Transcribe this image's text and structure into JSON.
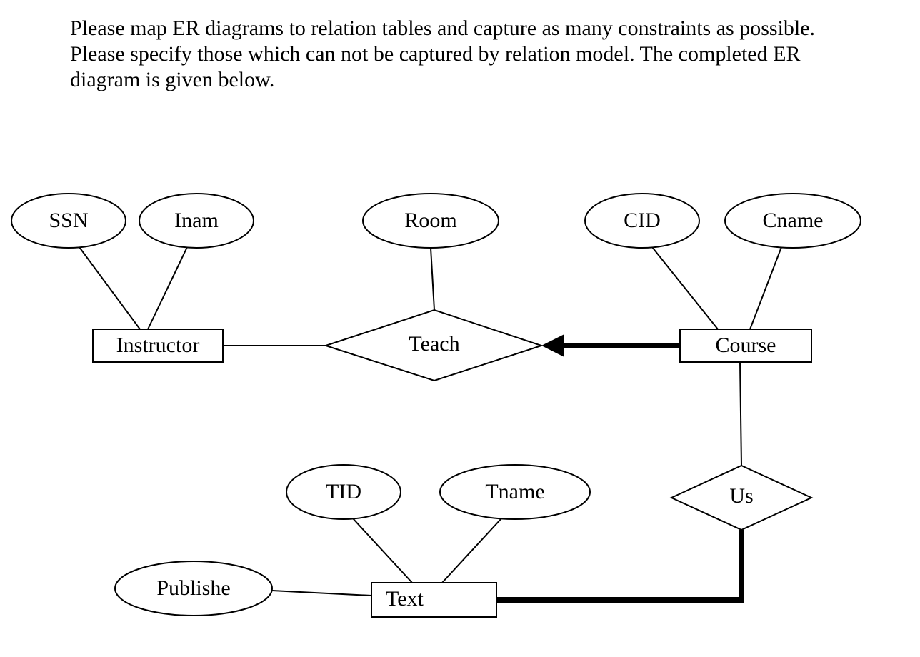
{
  "instruction": "Please map ER diagrams to relation tables and capture as many constraints as possible. Please specify those which can not be captured by relation model. The completed ER diagram is given below.",
  "entities": {
    "instructor": {
      "name": "Instructor",
      "attributes": [
        "SSN",
        "Inam"
      ]
    },
    "course": {
      "name": "Course",
      "attributes": [
        "CID",
        "Cname"
      ]
    },
    "text": {
      "name": "Text",
      "attributes": [
        "TID",
        "Tname",
        "Publishe"
      ]
    }
  },
  "relationships": {
    "teach": {
      "name": "Teach",
      "attributes": [
        "Room"
      ]
    },
    "us": {
      "name": "Us"
    }
  },
  "labels": {
    "ssn": "SSN",
    "inam": "Inam",
    "room": "Room",
    "cid": "CID",
    "cname": "Cname",
    "instructor": "Instructor",
    "teach": "Teach",
    "course": "Course",
    "tid": "TID",
    "tname": "Tname",
    "us": "Us",
    "publishe": "Publishe",
    "text": "Text"
  }
}
